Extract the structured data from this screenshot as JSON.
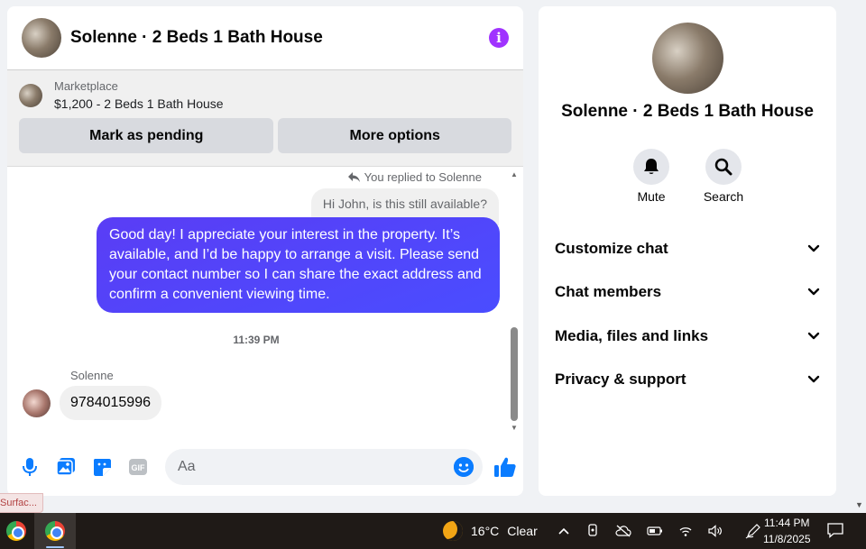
{
  "chat": {
    "title": "Solenne · 2 Beds 1 Bath House",
    "marketplace": {
      "label": "Marketplace",
      "listing": "$1,200 - 2 Beds 1 Bath House",
      "mark_pending": "Mark as pending",
      "more_options": "More options"
    },
    "messages": {
      "replied_note": "You replied to Solenne",
      "quoted_text": "Hi John, is this still available?",
      "outgoing": "Good day! I appreciate your interest in the property. It’s available, and I’d be happy to arrange a visit. Please send your contact number so I can share the exact address and confirm a convenient viewing time.",
      "timestamp": "11:39 PM",
      "sender_name": "Solenne",
      "incoming": "9784015996"
    },
    "composer": {
      "placeholder": "Aa",
      "icons": [
        "microphone-icon",
        "photo-icon",
        "sticker-icon",
        "gif-icon",
        "emoji-icon",
        "thumbs-up-icon"
      ],
      "gif_label": "GIF"
    }
  },
  "surface_tab": "Surfac...",
  "info_panel": {
    "title": "Solenne · 2 Beds 1 Bath House",
    "actions": [
      {
        "label": "Mute",
        "icon": "bell-icon"
      },
      {
        "label": "Search",
        "icon": "search-icon"
      }
    ],
    "sections": [
      {
        "label": "Customize chat"
      },
      {
        "label": "Chat members"
      },
      {
        "label": "Media, files and links"
      },
      {
        "label": "Privacy & support"
      }
    ]
  },
  "taskbar": {
    "weather_temp": "16°C",
    "weather_desc": "Clear",
    "time": "11:44 PM",
    "date": "11/8/2025"
  },
  "colors": {
    "accent": "#a033ff",
    "outgoing_bubble": "#4a4dff",
    "brand_blue": "#0a7cff"
  }
}
